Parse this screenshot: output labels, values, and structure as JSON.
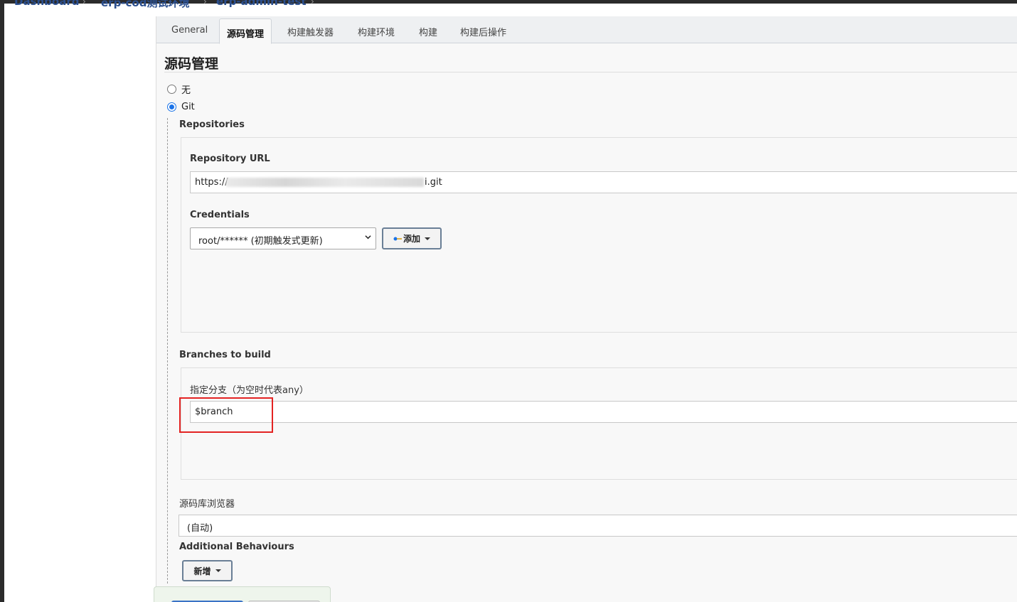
{
  "breadcrumb": {
    "items": [
      "Dashboard",
      "erp-cod测试环境",
      "erp-admin-test"
    ]
  },
  "tabs": [
    {
      "label": "General",
      "active": false
    },
    {
      "label": "源码管理",
      "active": true
    },
    {
      "label": "构建触发器",
      "active": false
    },
    {
      "label": "构建环境",
      "active": false
    },
    {
      "label": "构建",
      "active": false
    },
    {
      "label": "构建后操作",
      "active": false
    }
  ],
  "scm": {
    "title": "源码管理",
    "option_none": "无",
    "option_git": "Git",
    "selected": "Git",
    "repositories_label": "Repositories",
    "repo_url_label": "Repository URL",
    "repo_url_prefix": "https://",
    "repo_url_suffix": "i.git",
    "credentials_label": "Credentials",
    "credentials_value": "root/****** (初期触发式更新)",
    "add_button": "添加",
    "branches_label": "Branches to build",
    "branch_spec_label": "指定分支（为空时代表any）",
    "branch_spec_value": "$branch",
    "browser_label": "源码库浏览器",
    "browser_value": "(自动)",
    "behaviours_label": "Additional Behaviours",
    "new_button": "新增"
  },
  "colors": {
    "highlight": "#e32322",
    "radio_accent": "#1a73e8",
    "breadcrumb_link": "#2b4f8f"
  }
}
